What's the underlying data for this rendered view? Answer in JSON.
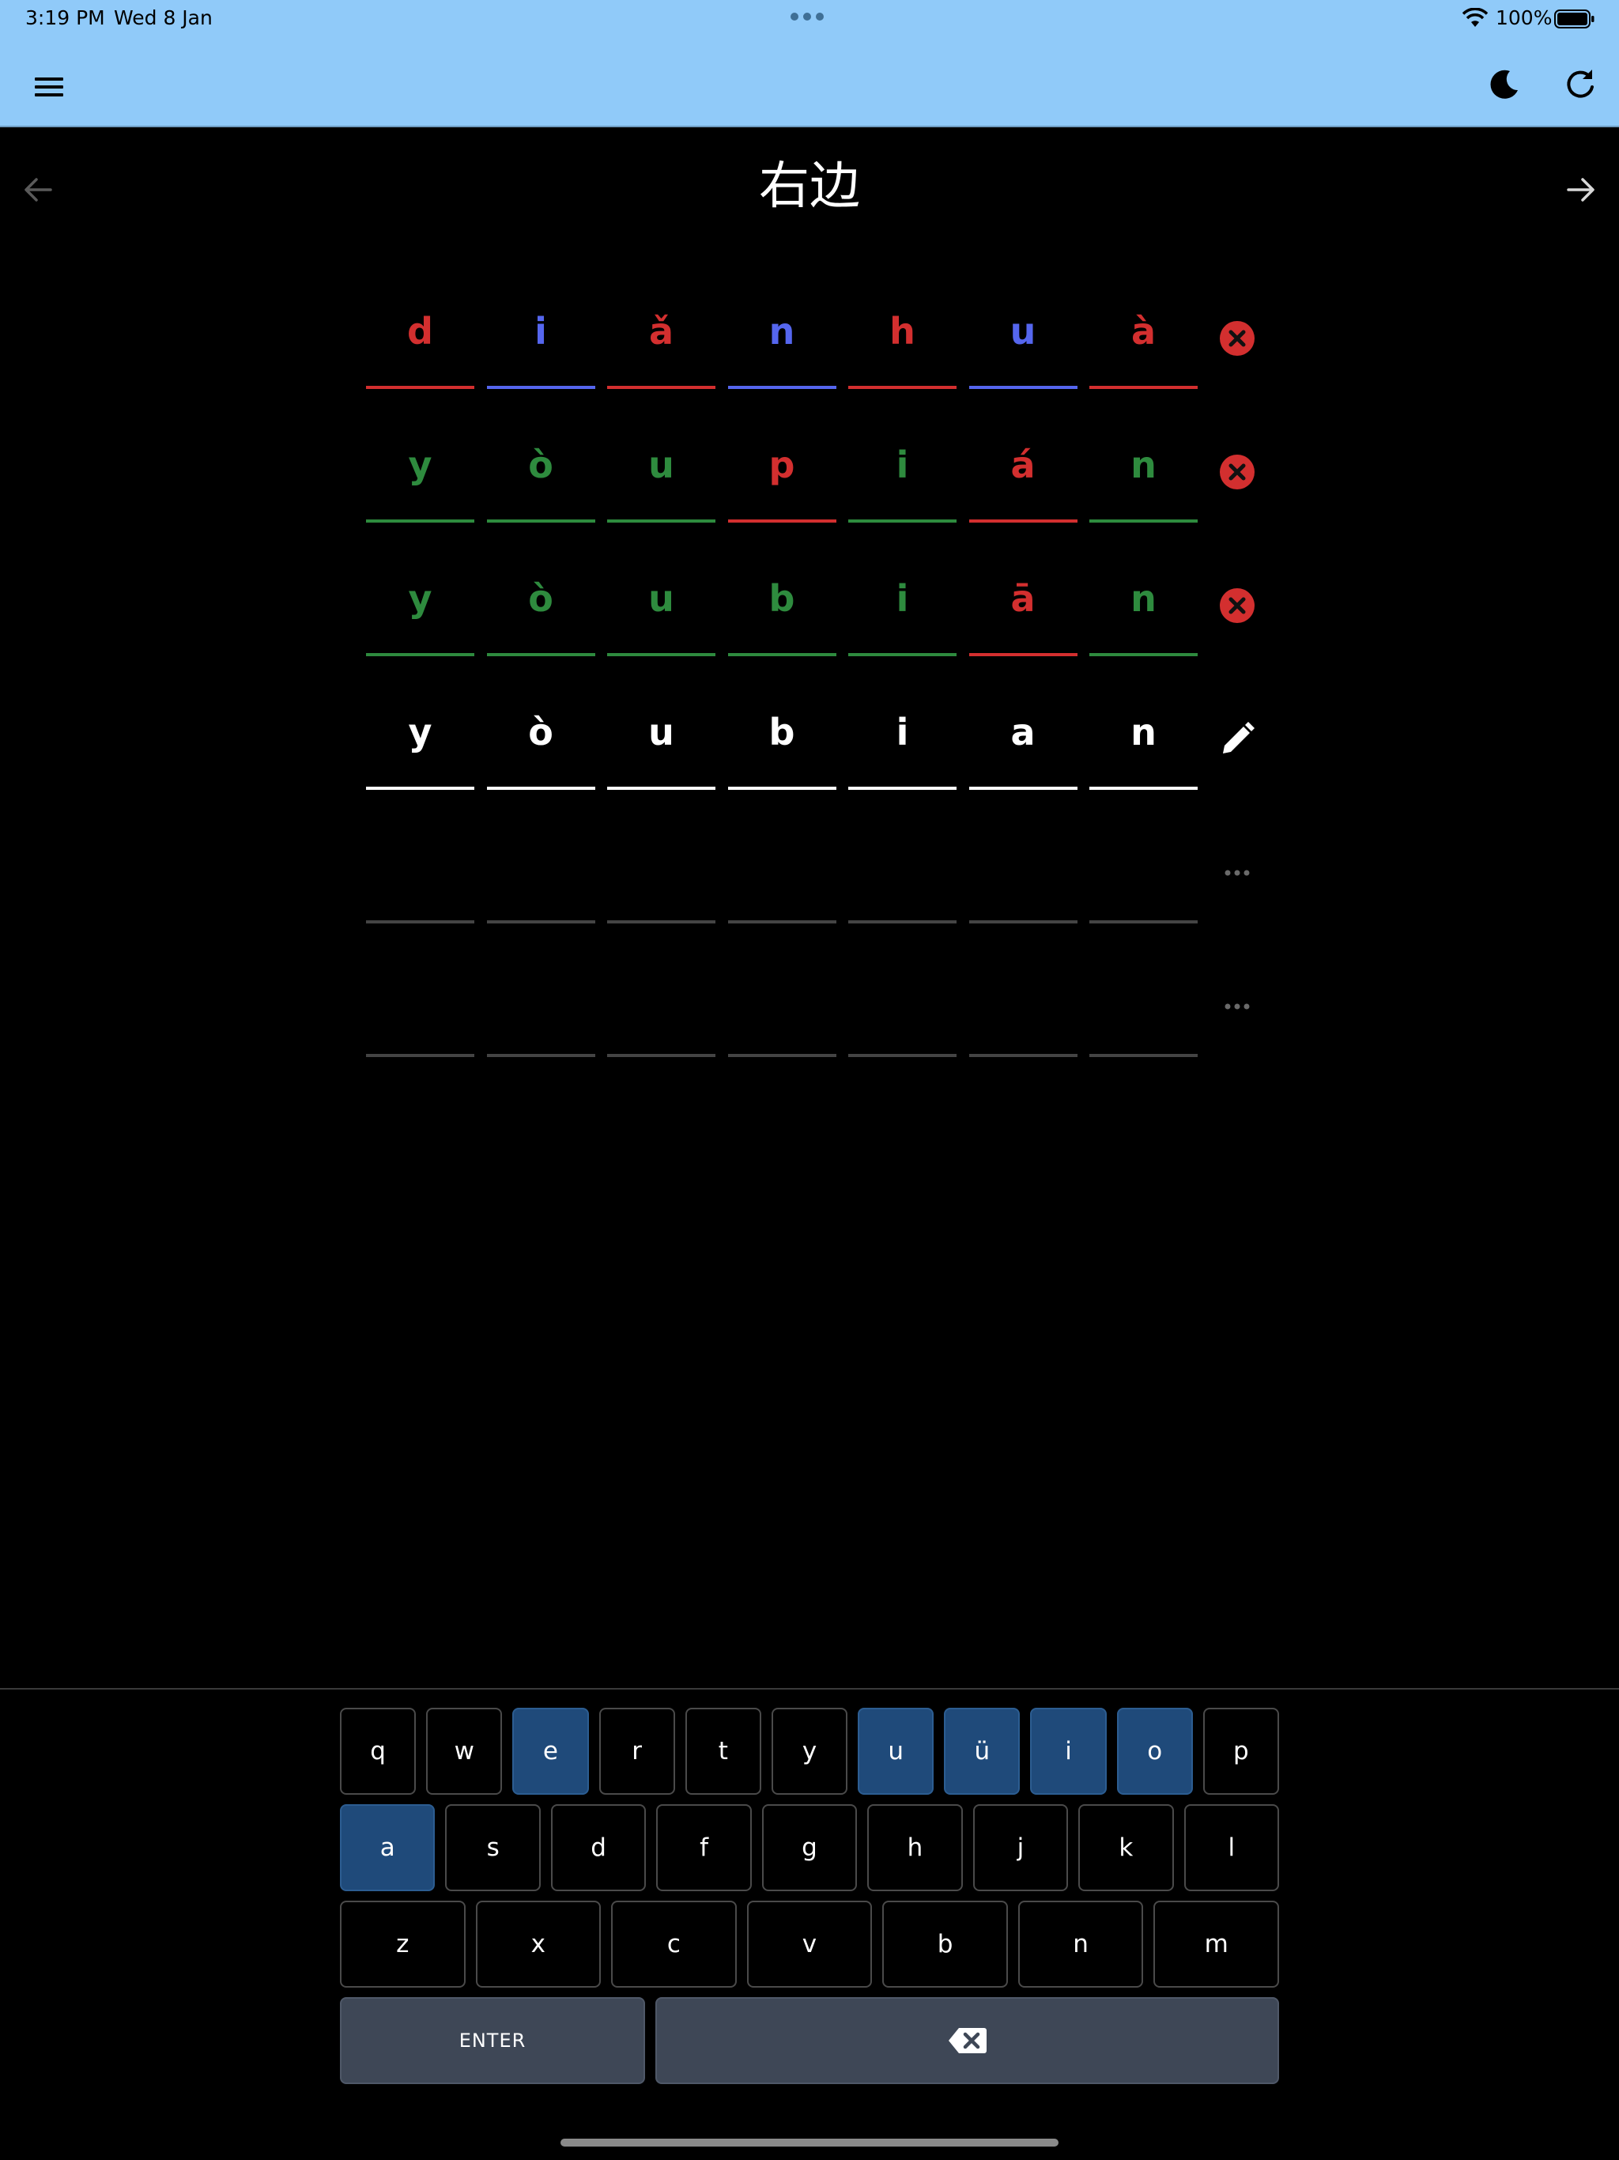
{
  "status_bar": {
    "time": "3:19 PM",
    "date": "Wed 8 Jan",
    "battery": "100%"
  },
  "app_bar": {
    "menu_icon": "hamburger-menu-icon",
    "theme_icon": "moon-icon",
    "refresh_icon": "refresh-icon"
  },
  "header": {
    "word": "右边",
    "prev_icon": "arrow-left-icon",
    "next_icon": "arrow-right-icon"
  },
  "colors": {
    "red": "#d32f2f",
    "blue": "#5566ee",
    "green": "#2e8b3e",
    "appbar": "#90caf9",
    "vowel_key": "#1f4a7a",
    "action_key": "#3e4756"
  },
  "rows": [
    {
      "status": "incorrect",
      "status_icon": "error-x-circle-icon",
      "cells": [
        {
          "letter": "d",
          "color": "red"
        },
        {
          "letter": "i",
          "color": "blue"
        },
        {
          "letter": "ǎ",
          "color": "red"
        },
        {
          "letter": "n",
          "color": "blue"
        },
        {
          "letter": "h",
          "color": "red"
        },
        {
          "letter": "u",
          "color": "blue"
        },
        {
          "letter": "à",
          "color": "red"
        }
      ]
    },
    {
      "status": "incorrect",
      "status_icon": "error-x-circle-icon",
      "cells": [
        {
          "letter": "y",
          "color": "green"
        },
        {
          "letter": "ò",
          "color": "green"
        },
        {
          "letter": "u",
          "color": "green"
        },
        {
          "letter": "p",
          "color": "red"
        },
        {
          "letter": "i",
          "color": "green"
        },
        {
          "letter": "á",
          "color": "red"
        },
        {
          "letter": "n",
          "color": "green"
        }
      ]
    },
    {
      "status": "incorrect",
      "status_icon": "error-x-circle-icon",
      "cells": [
        {
          "letter": "y",
          "color": "green"
        },
        {
          "letter": "ò",
          "color": "green"
        },
        {
          "letter": "u",
          "color": "green"
        },
        {
          "letter": "b",
          "color": "green"
        },
        {
          "letter": "i",
          "color": "green"
        },
        {
          "letter": "ā",
          "color": "red"
        },
        {
          "letter": "n",
          "color": "green"
        }
      ]
    },
    {
      "status": "editing",
      "status_icon": "pencil-icon",
      "cells": [
        {
          "letter": "y",
          "color": "white"
        },
        {
          "letter": "ò",
          "color": "white"
        },
        {
          "letter": "u",
          "color": "white"
        },
        {
          "letter": "b",
          "color": "white"
        },
        {
          "letter": "i",
          "color": "white"
        },
        {
          "letter": "a",
          "color": "white"
        },
        {
          "letter": "n",
          "color": "white"
        }
      ]
    },
    {
      "status": "pending",
      "status_icon": "ellipsis-icon",
      "cells": [
        {
          "letter": "",
          "color": "empty"
        },
        {
          "letter": "",
          "color": "empty"
        },
        {
          "letter": "",
          "color": "empty"
        },
        {
          "letter": "",
          "color": "empty"
        },
        {
          "letter": "",
          "color": "empty"
        },
        {
          "letter": "",
          "color": "empty"
        },
        {
          "letter": "",
          "color": "empty"
        }
      ]
    },
    {
      "status": "pending",
      "status_icon": "ellipsis-icon",
      "cells": [
        {
          "letter": "",
          "color": "empty"
        },
        {
          "letter": "",
          "color": "empty"
        },
        {
          "letter": "",
          "color": "empty"
        },
        {
          "letter": "",
          "color": "empty"
        },
        {
          "letter": "",
          "color": "empty"
        },
        {
          "letter": "",
          "color": "empty"
        },
        {
          "letter": "",
          "color": "empty"
        }
      ]
    }
  ],
  "keyboard": {
    "row1": [
      {
        "label": "q",
        "vowel": false
      },
      {
        "label": "w",
        "vowel": false
      },
      {
        "label": "e",
        "vowel": true
      },
      {
        "label": "r",
        "vowel": false
      },
      {
        "label": "t",
        "vowel": false
      },
      {
        "label": "y",
        "vowel": false
      },
      {
        "label": "u",
        "vowel": true
      },
      {
        "label": "ü",
        "vowel": true
      },
      {
        "label": "i",
        "vowel": true
      },
      {
        "label": "o",
        "vowel": true
      },
      {
        "label": "p",
        "vowel": false
      }
    ],
    "row2": [
      {
        "label": "a",
        "vowel": true
      },
      {
        "label": "s",
        "vowel": false
      },
      {
        "label": "d",
        "vowel": false
      },
      {
        "label": "f",
        "vowel": false
      },
      {
        "label": "g",
        "vowel": false
      },
      {
        "label": "h",
        "vowel": false
      },
      {
        "label": "j",
        "vowel": false
      },
      {
        "label": "k",
        "vowel": false
      },
      {
        "label": "l",
        "vowel": false
      }
    ],
    "row3": [
      {
        "label": "z",
        "vowel": false
      },
      {
        "label": "x",
        "vowel": false
      },
      {
        "label": "c",
        "vowel": false
      },
      {
        "label": "v",
        "vowel": false
      },
      {
        "label": "b",
        "vowel": false
      },
      {
        "label": "n",
        "vowel": false
      },
      {
        "label": "m",
        "vowel": false
      }
    ],
    "enter_label": "ENTER",
    "backspace_icon": "backspace-icon"
  }
}
